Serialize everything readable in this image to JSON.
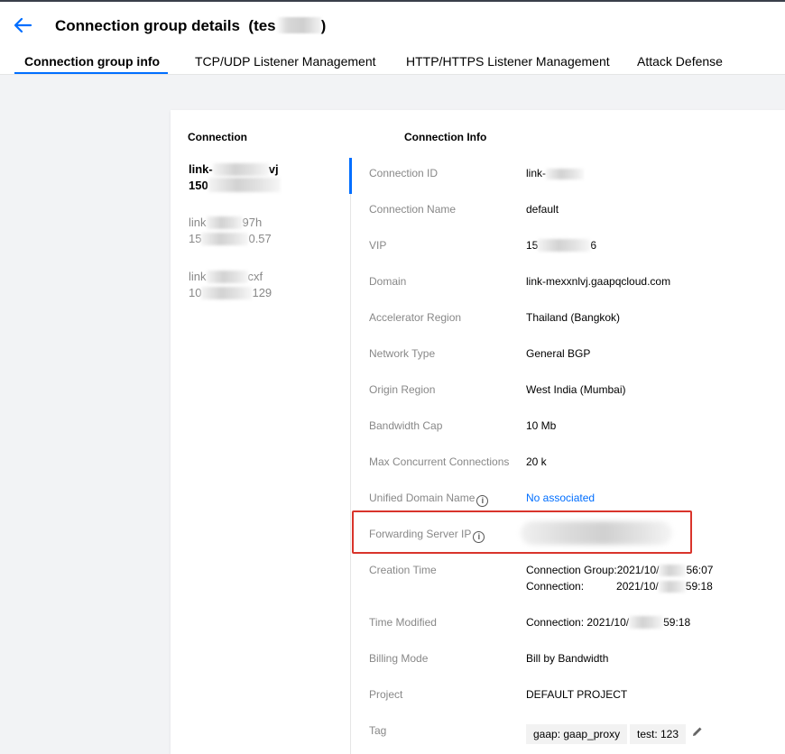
{
  "header": {
    "title": "Connection group details",
    "title_suffix_prefix": "(tes",
    "title_suffix_end": ")",
    "tabs": [
      {
        "label": "Connection group info",
        "active": true
      },
      {
        "label": "TCP/UDP Listener Management",
        "active": false
      },
      {
        "label": "HTTP/HTTPS Listener Management",
        "active": false
      },
      {
        "label": "Attack Defense",
        "active": false
      }
    ]
  },
  "connections": {
    "heading": "Connection",
    "items": [
      {
        "line1_start": "link-",
        "line1_end": "vj",
        "line2_start": "150",
        "line2_end": ""
      },
      {
        "line1_start": "link",
        "line1_end": "97h",
        "line2_start": "15",
        "line2_end": "0.57"
      },
      {
        "line1_start": "link",
        "line1_end": "cxf",
        "line2_start": "10",
        "line2_end": "129"
      }
    ]
  },
  "info": {
    "heading": "Connection Info",
    "rows": {
      "connection_id": {
        "label": "Connection ID",
        "value": "link-"
      },
      "connection_name": {
        "label": "Connection Name",
        "value": "default"
      },
      "vip": {
        "label": "VIP",
        "value_start": "15",
        "value_end": "6"
      },
      "domain": {
        "label": "Domain",
        "value": "link-mexxnlvj.gaapqcloud.com"
      },
      "accelerator_region": {
        "label": "Accelerator Region",
        "value": "Thailand (Bangkok)"
      },
      "network_type": {
        "label": "Network Type",
        "value": "General BGP"
      },
      "origin_region": {
        "label": "Origin Region",
        "value": "West India (Mumbai)"
      },
      "bandwidth_cap": {
        "label": "Bandwidth Cap",
        "value": "10 Mb"
      },
      "max_concurrent": {
        "label": "Max Concurrent Connections",
        "value": "20 k"
      },
      "unified_domain": {
        "label": "Unified Domain Name",
        "value": "No associated"
      },
      "forwarding_ip": {
        "label": "Forwarding Server IP"
      },
      "creation_time": {
        "label": "Creation Time",
        "group_prefix": "Connection Group:",
        "group_start": "2021/10/",
        "group_end": "56:07",
        "conn_prefix": "Connection:",
        "conn_start": "2021/10/",
        "conn_end": "59:18"
      },
      "time_modified": {
        "label": "Time Modified",
        "value_start": "Connection: 2021/10/",
        "value_end": "59:18"
      },
      "billing_mode": {
        "label": "Billing Mode",
        "value": "Bill by Bandwidth"
      },
      "project": {
        "label": "Project",
        "value": "DEFAULT PROJECT"
      },
      "tag": {
        "label": "Tag",
        "tags": [
          "gaap: gaap_proxy",
          "test: 123"
        ]
      }
    }
  },
  "colors": {
    "accent": "#006eff",
    "highlight": "#d9342b"
  }
}
